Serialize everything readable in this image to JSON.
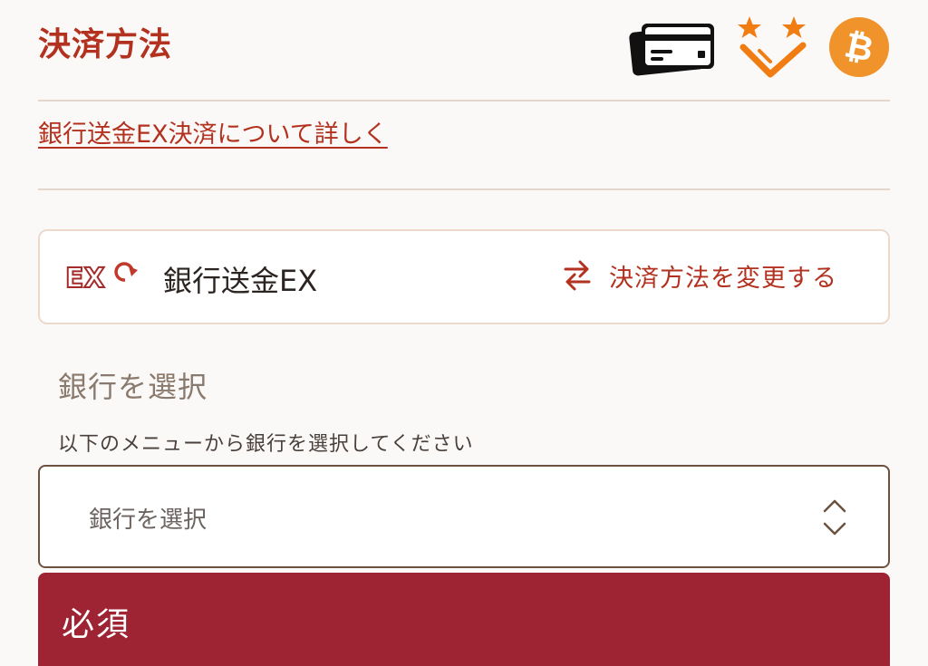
{
  "header": {
    "title": "決済方法",
    "payment_icons": [
      "credit-card-icon",
      "points-icon",
      "bitcoin-icon"
    ]
  },
  "info": {
    "link_text": "銀行送金EX決済について詳しく"
  },
  "method": {
    "logo_text": "EX",
    "name": "銀行送金EX",
    "change_label": "決済方法を変更する"
  },
  "bank_section": {
    "title": "銀行を選択",
    "description": "以下のメニューから銀行を選択してください",
    "select_value": "銀行を選択",
    "required_label": "必須"
  },
  "colors": {
    "accent": "#b3321f",
    "required_bg": "#9e2433",
    "bitcoin": "#f0932b",
    "points": "#f07c12",
    "background": "#fbf9f7"
  }
}
